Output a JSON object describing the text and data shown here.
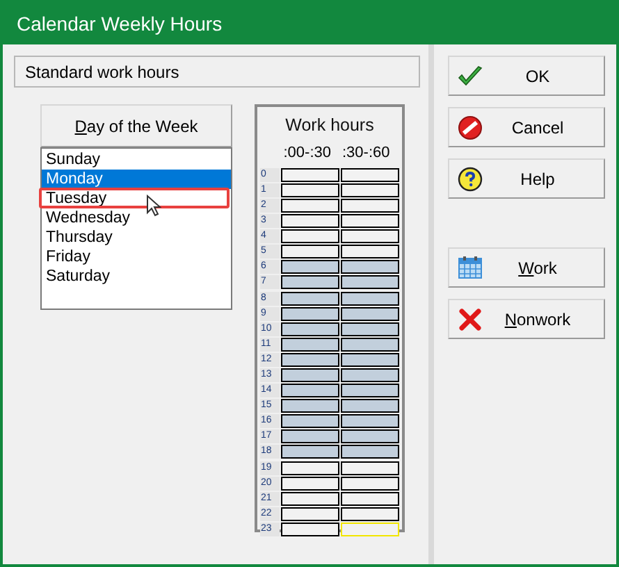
{
  "window": {
    "title": "Calendar Weekly Hours"
  },
  "section": {
    "title": "Standard work hours"
  },
  "day_header": {
    "label": "Day of the Week",
    "underline_first": true
  },
  "days": [
    {
      "label": "Sunday",
      "selected": false,
      "highlighted": false
    },
    {
      "label": "Monday",
      "selected": true,
      "highlighted": false
    },
    {
      "label": "Tuesday",
      "selected": false,
      "highlighted": true
    },
    {
      "label": "Wednesday",
      "selected": false,
      "highlighted": false
    },
    {
      "label": "Thursday",
      "selected": false,
      "highlighted": false
    },
    {
      "label": "Friday",
      "selected": false,
      "highlighted": false
    },
    {
      "label": "Saturday",
      "selected": false,
      "highlighted": false
    }
  ],
  "work_hours": {
    "title": "Work hours",
    "columns": [
      ":00-:30",
      ":30-:60"
    ],
    "hours": [
      {
        "hour": "0",
        "slots": [
          {
            "work": false,
            "focused": false
          },
          {
            "work": false,
            "focused": false
          }
        ]
      },
      {
        "hour": "1",
        "slots": [
          {
            "work": false,
            "focused": false
          },
          {
            "work": false,
            "focused": false
          }
        ]
      },
      {
        "hour": "2",
        "slots": [
          {
            "work": false,
            "focused": false
          },
          {
            "work": false,
            "focused": false
          }
        ]
      },
      {
        "hour": "3",
        "slots": [
          {
            "work": false,
            "focused": false
          },
          {
            "work": false,
            "focused": false
          }
        ]
      },
      {
        "hour": "4",
        "slots": [
          {
            "work": false,
            "focused": false
          },
          {
            "work": false,
            "focused": false
          }
        ]
      },
      {
        "hour": "5",
        "slots": [
          {
            "work": false,
            "focused": false
          },
          {
            "work": false,
            "focused": false
          }
        ]
      },
      {
        "hour": "6",
        "slots": [
          {
            "work": true,
            "focused": false
          },
          {
            "work": true,
            "focused": false
          }
        ]
      },
      {
        "hour": "7",
        "slots": [
          {
            "work": true,
            "focused": false
          },
          {
            "work": true,
            "focused": false
          }
        ]
      },
      {
        "hour": "8",
        "slots": [
          {
            "work": true,
            "focused": false
          },
          {
            "work": true,
            "focused": false
          }
        ]
      },
      {
        "hour": "9",
        "slots": [
          {
            "work": true,
            "focused": false
          },
          {
            "work": true,
            "focused": false
          }
        ]
      },
      {
        "hour": "10",
        "slots": [
          {
            "work": true,
            "focused": false
          },
          {
            "work": true,
            "focused": false
          }
        ]
      },
      {
        "hour": "11",
        "slots": [
          {
            "work": true,
            "focused": false
          },
          {
            "work": true,
            "focused": false
          }
        ]
      },
      {
        "hour": "12",
        "slots": [
          {
            "work": true,
            "focused": false
          },
          {
            "work": true,
            "focused": false
          }
        ]
      },
      {
        "hour": "13",
        "slots": [
          {
            "work": true,
            "focused": false
          },
          {
            "work": true,
            "focused": false
          }
        ]
      },
      {
        "hour": "14",
        "slots": [
          {
            "work": true,
            "focused": false
          },
          {
            "work": true,
            "focused": false
          }
        ]
      },
      {
        "hour": "15",
        "slots": [
          {
            "work": true,
            "focused": false
          },
          {
            "work": true,
            "focused": false
          }
        ]
      },
      {
        "hour": "16",
        "slots": [
          {
            "work": true,
            "focused": false
          },
          {
            "work": true,
            "focused": false
          }
        ]
      },
      {
        "hour": "17",
        "slots": [
          {
            "work": true,
            "focused": false
          },
          {
            "work": true,
            "focused": false
          }
        ]
      },
      {
        "hour": "18",
        "slots": [
          {
            "work": true,
            "focused": false
          },
          {
            "work": true,
            "focused": false
          }
        ]
      },
      {
        "hour": "19",
        "slots": [
          {
            "work": false,
            "focused": false
          },
          {
            "work": false,
            "focused": false
          }
        ]
      },
      {
        "hour": "20",
        "slots": [
          {
            "work": false,
            "focused": false
          },
          {
            "work": false,
            "focused": false
          }
        ]
      },
      {
        "hour": "21",
        "slots": [
          {
            "work": false,
            "focused": false
          },
          {
            "work": false,
            "focused": false
          }
        ]
      },
      {
        "hour": "22",
        "slots": [
          {
            "work": false,
            "focused": false
          },
          {
            "work": false,
            "focused": false
          }
        ]
      },
      {
        "hour": "23",
        "slots": [
          {
            "work": false,
            "focused": false
          },
          {
            "work": false,
            "focused": true
          }
        ]
      }
    ]
  },
  "buttons": [
    {
      "kind": "ok",
      "label": "OK",
      "underline_first": false
    },
    {
      "kind": "cancel",
      "label": "Cancel",
      "underline_first": false
    },
    {
      "kind": "help",
      "label": "Help",
      "underline_first": false
    },
    {
      "kind": "work",
      "label": "Work",
      "underline_first": true
    },
    {
      "kind": "nonwork",
      "label": "Nonwork",
      "underline_first": true
    }
  ]
}
